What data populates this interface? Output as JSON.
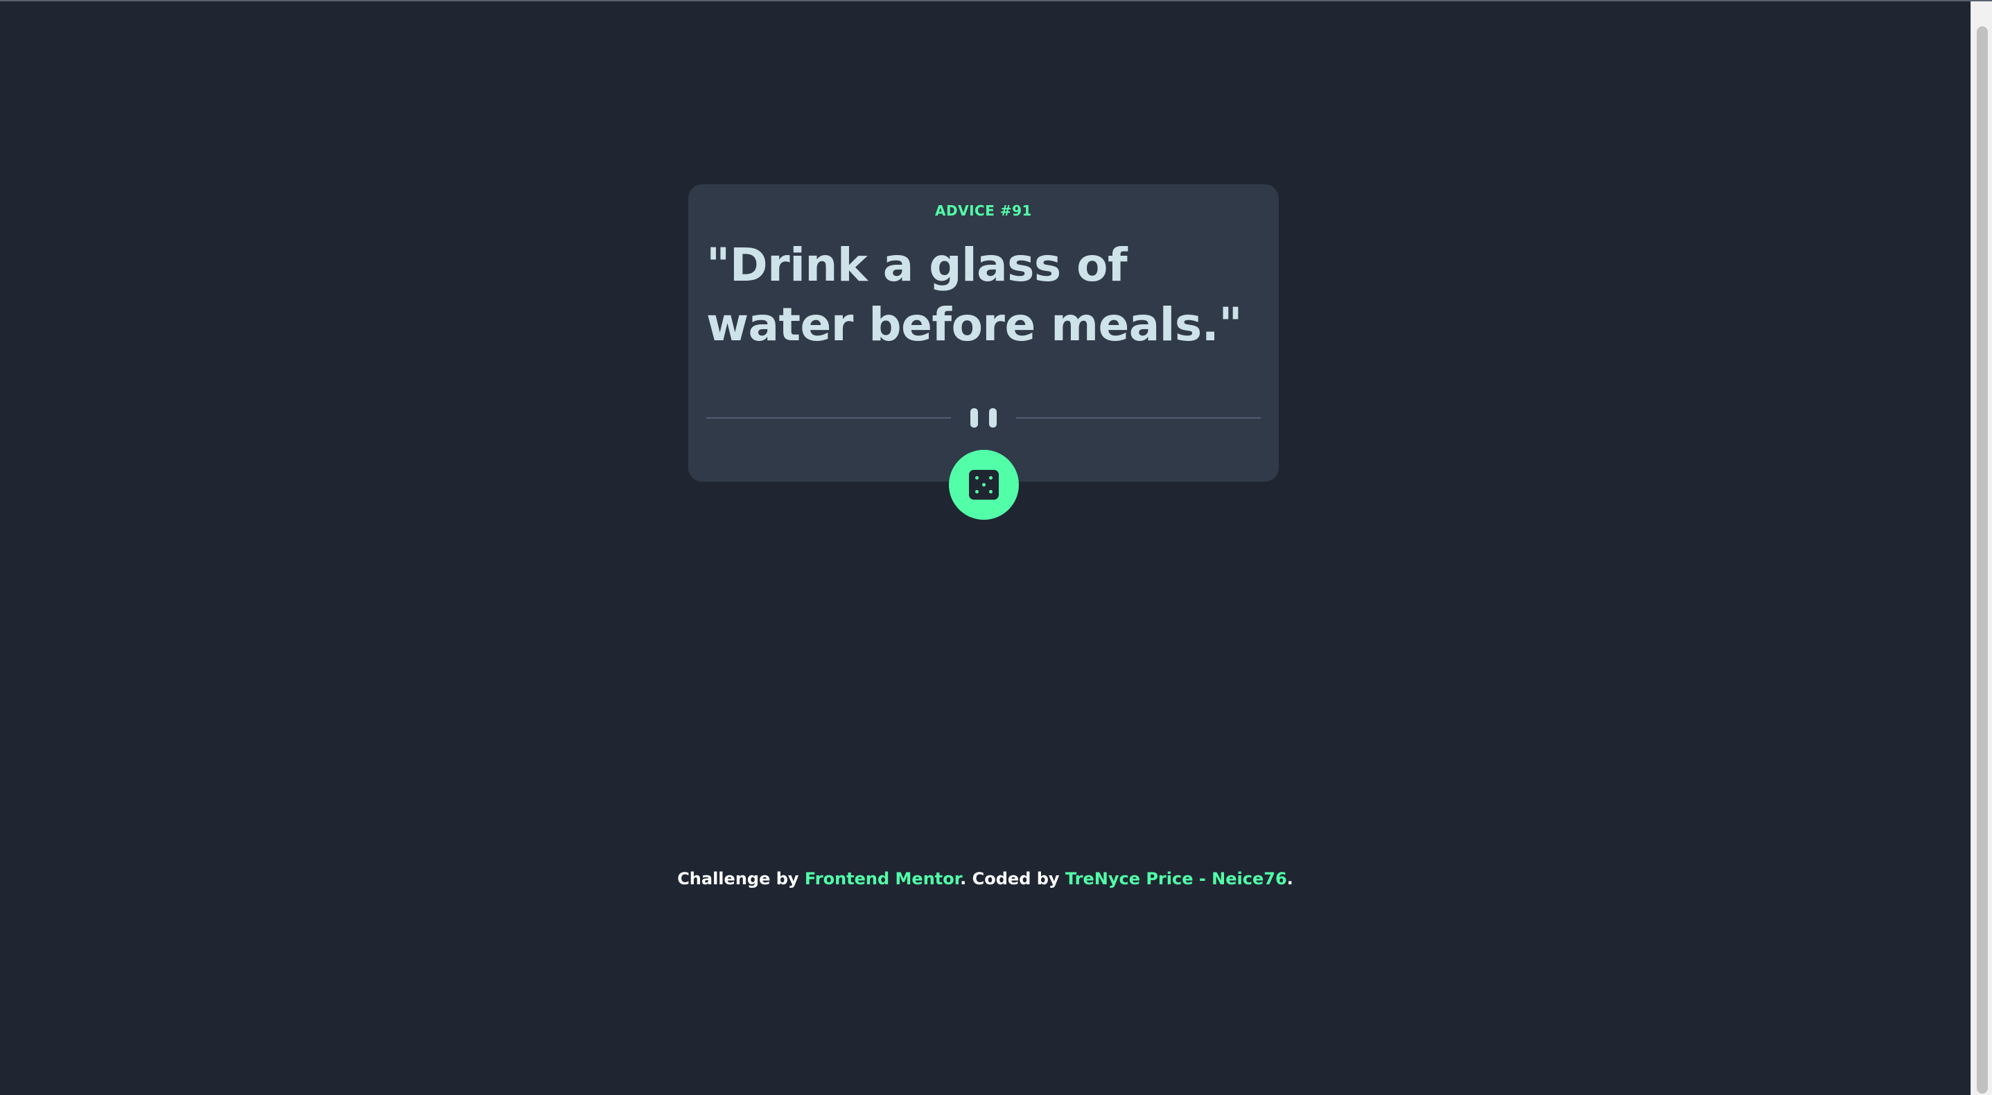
{
  "advice": {
    "label": "ADVICE #91",
    "quote": "\"Drink a glass of water before meals.\""
  },
  "divider": {
    "icon": "pause-icon"
  },
  "dice_button": {
    "icon": "dice-icon"
  },
  "footer": {
    "prefix": "Challenge by ",
    "mentor_link": "Frontend Mentor",
    "middle": ". Coded by ",
    "author_link": "TreNyce Price - Neice76",
    "suffix": "."
  },
  "colors": {
    "background": "#1f2632",
    "card": "#313a48",
    "accent": "#52ffa8",
    "quote_text": "#cee3e9",
    "divider": "#4f5d74"
  }
}
